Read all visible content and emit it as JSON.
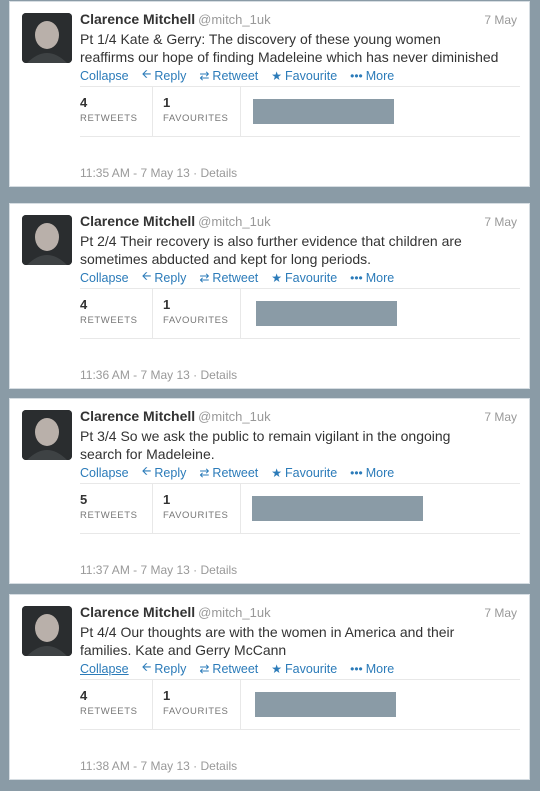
{
  "tweets": [
    {
      "author": "Clarence Mitchell",
      "handle": "@mitch_1uk",
      "date": "7 May",
      "text_line1": "Pt 1/4 Kate & Gerry: The discovery of these young women",
      "text_line2": "reaffirms our hope of finding Madeleine which has never diminished",
      "collapse": "Collapse",
      "reply": "Reply",
      "retweet": "Retweet",
      "favourite": "Favourite",
      "more": "More",
      "retweets_count": "4",
      "retweets_label": "RETWEETS",
      "favourites_count": "1",
      "favourites_label": "FAVOURITES",
      "timestamp": "11:35 AM - 7 May 13 · Details"
    },
    {
      "author": "Clarence Mitchell",
      "handle": "@mitch_1uk",
      "date": "7 May",
      "text_line1": "Pt 2/4 Their recovery is also further evidence that children are",
      "text_line2": "sometimes abducted and kept for long periods.",
      "collapse": "Collapse",
      "reply": "Reply",
      "retweet": "Retweet",
      "favourite": "Favourite",
      "more": "More",
      "retweets_count": "4",
      "retweets_label": "RETWEETS",
      "favourites_count": "1",
      "favourites_label": "FAVOURITES",
      "timestamp": "11:36 AM - 7 May 13 · Details"
    },
    {
      "author": "Clarence Mitchell",
      "handle": "@mitch_1uk",
      "date": "7 May",
      "text_line1": "Pt 3/4 So we ask the public to remain vigilant in the ongoing",
      "text_line2": "search for Madeleine.",
      "collapse": "Collapse",
      "reply": "Reply",
      "retweet": "Retweet",
      "favourite": "Favourite",
      "more": "More",
      "retweets_count": "5",
      "retweets_label": "RETWEETS",
      "favourites_count": "1",
      "favourites_label": "FAVOURITES",
      "timestamp": "11:37 AM - 7 May 13 · Details"
    },
    {
      "author": "Clarence Mitchell",
      "handle": "@mitch_1uk",
      "date": "7 May",
      "text_line1": "Pt 4/4 Our thoughts are with the women in America and their",
      "text_line2": "families. Kate and Gerry McCann",
      "collapse": "Collapse",
      "reply": "Reply",
      "retweet": "Retweet",
      "favourite": "Favourite",
      "more": "More",
      "retweets_count": "4",
      "retweets_label": "RETWEETS",
      "favourites_count": "1",
      "favourites_label": "FAVOURITES",
      "timestamp": "11:38 AM - 7 May 13 · Details"
    }
  ],
  "colors": {
    "link": "#2b7bb9",
    "background": "#8a9ba6",
    "redaction": "#8a9ba6",
    "muted_text": "#999999"
  },
  "icons": [
    "reply-icon",
    "retweet-icon",
    "favourite-star-icon",
    "more-dots-icon",
    "avatar"
  ]
}
